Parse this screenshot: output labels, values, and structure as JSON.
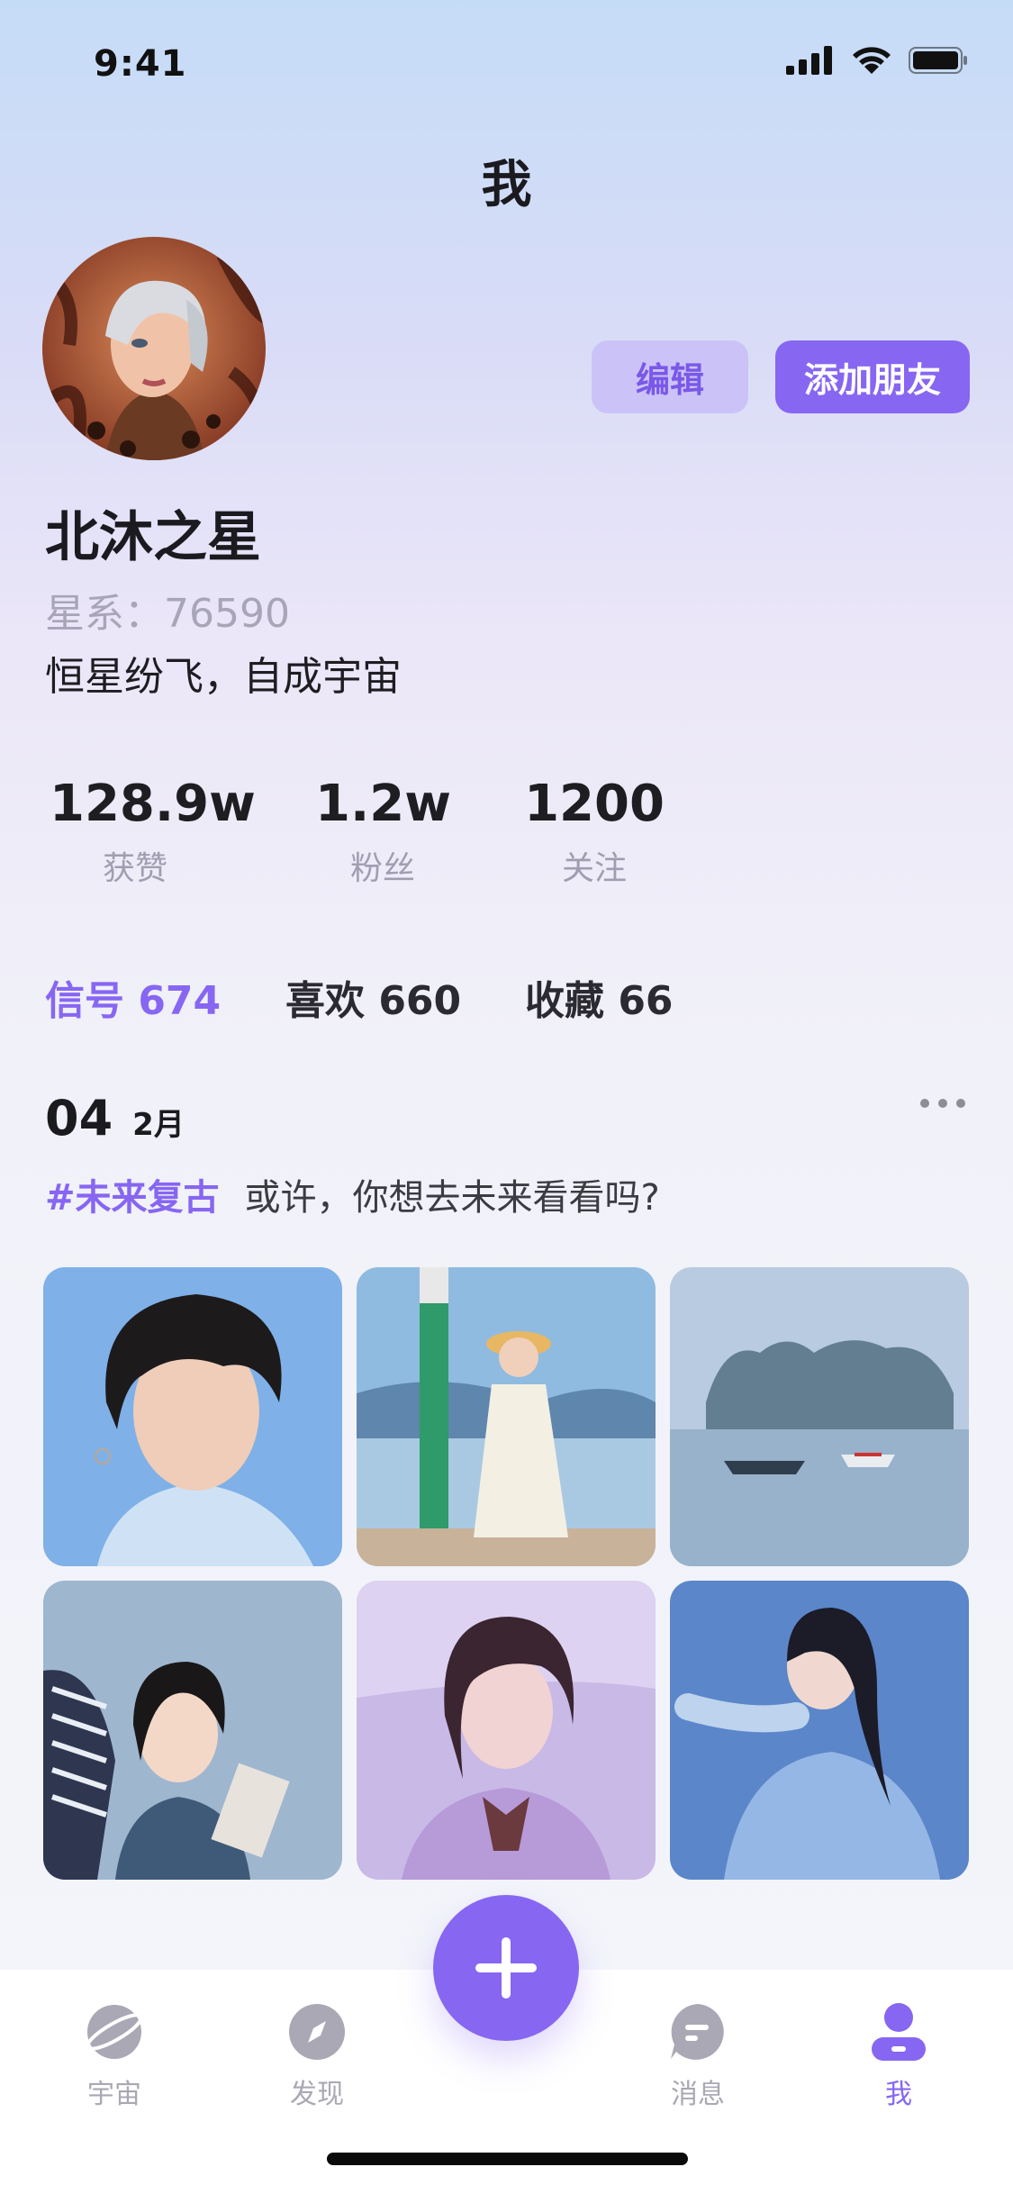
{
  "status_bar": {
    "time": "9:41"
  },
  "nav": {
    "title": "我"
  },
  "profile": {
    "edit_label": "编辑",
    "add_friend_label": "添加朋友",
    "username": "北沐之星",
    "galaxy_id": "星系：76590",
    "bio": "恒星纷飞，自成宇宙"
  },
  "stats": [
    {
      "value": "128.9w",
      "label": "获赞"
    },
    {
      "value": "1.2w",
      "label": "粉丝"
    },
    {
      "value": "1200",
      "label": "关注"
    }
  ],
  "content_tabs": [
    {
      "label": "信号 674",
      "active": true
    },
    {
      "label": "喜欢 660",
      "active": false
    },
    {
      "label": "收藏 66",
      "active": false
    }
  ],
  "post": {
    "day": "04",
    "month": "2月",
    "tag": "#未来复古",
    "text": "或许，你想去未来看看吗?"
  },
  "tabbar": {
    "items": [
      {
        "label": "宇宙",
        "icon": "planet-icon"
      },
      {
        "label": "发现",
        "icon": "compass-icon"
      },
      {
        "label": "消息",
        "icon": "message-icon"
      },
      {
        "label": "我",
        "icon": "user-icon",
        "active": true
      }
    ]
  },
  "colors": {
    "accent": "#8766f2",
    "accent_light": "#cbc3f7",
    "muted": "#a9a5b8"
  }
}
